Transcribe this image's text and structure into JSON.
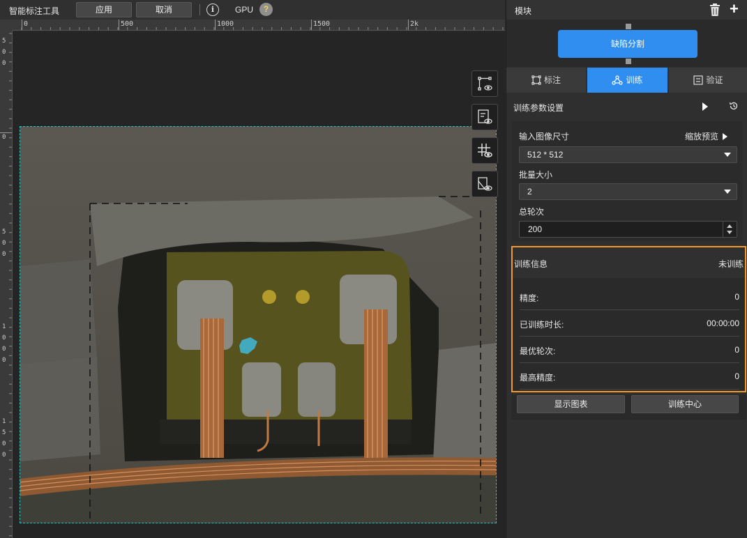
{
  "toolbar": {
    "title": "智能标注工具",
    "apply_label": "应用",
    "cancel_label": "取消",
    "info_glyph": "i",
    "gpu_label": "GPU",
    "help_glyph": "?"
  },
  "ruler": {
    "top_labels": [
      "0",
      "500",
      "1000",
      "1500",
      "2k"
    ],
    "left_labels": [
      "5",
      "0",
      "0",
      "0",
      "5",
      "0",
      "0",
      "1",
      "0",
      "0",
      "0",
      "1",
      "5",
      "0",
      "0"
    ]
  },
  "canvas": {
    "side_tools": [
      "annotation-visibility-icon",
      "checklist-visibility-icon",
      "grid-visibility-icon",
      "mask-visibility-icon"
    ]
  },
  "panel": {
    "title": "模块",
    "module_button": "缺陷分割",
    "tabs": [
      {
        "label": "标注",
        "icon": "annotation-icon"
      },
      {
        "label": "训练",
        "icon": "train-icon"
      },
      {
        "label": "验证",
        "icon": "validate-icon"
      }
    ],
    "active_tab": "训练",
    "train_params": {
      "title": "训练参数设置",
      "input_size_label": "输入图像尺寸",
      "zoom_preview_label": "缩放预览",
      "input_size_value": "512 * 512",
      "batch_size_label": "批量大小",
      "batch_size_value": "2",
      "epochs_label": "总轮次",
      "epochs_value": "200"
    },
    "train_info": {
      "title": "训练信息",
      "status": "未训练",
      "rows": [
        {
          "key": "精度:",
          "value": "0"
        },
        {
          "key": "已训练时长:",
          "value": "00:00:00"
        },
        {
          "key": "最优轮次:",
          "value": "0"
        },
        {
          "key": "最高精度:",
          "value": "0"
        }
      ]
    },
    "show_chart_label": "显示图表",
    "training_center_label": "训练中心"
  },
  "colors": {
    "accent": "#2f8ef0",
    "highlight_border": "#f29b2c",
    "selection_border": "#2ec4c4",
    "annotation_fill": "#3fb8d8"
  }
}
